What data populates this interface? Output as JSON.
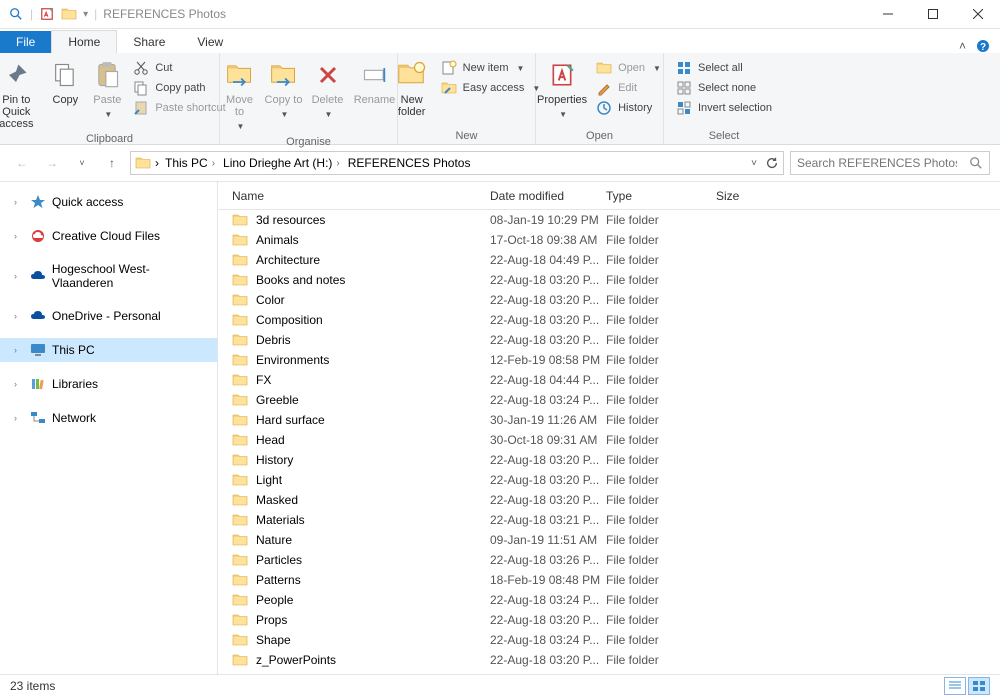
{
  "window": {
    "title": "REFERENCES Photos"
  },
  "tabs": {
    "file": "File",
    "home": "Home",
    "share": "Share",
    "view": "View"
  },
  "ribbon": {
    "pin": "Pin to Quick access",
    "copy": "Copy",
    "paste": "Paste",
    "cut": "Cut",
    "copypath": "Copy path",
    "pasteshortcut": "Paste shortcut",
    "clipboard_label": "Clipboard",
    "moveto": "Move to",
    "copyto": "Copy to",
    "delete": "Delete",
    "rename": "Rename",
    "organise_label": "Organise",
    "newfolder": "New folder",
    "newitem": "New item",
    "easyaccess": "Easy access",
    "new_label": "New",
    "properties": "Properties",
    "open": "Open",
    "edit": "Edit",
    "history": "History",
    "open_label": "Open",
    "selectall": "Select all",
    "selectnone": "Select none",
    "invert": "Invert selection",
    "select_label": "Select"
  },
  "breadcrumb": [
    "This PC",
    "Lino Drieghe Art (H:)",
    "REFERENCES Photos"
  ],
  "search_placeholder": "Search REFERENCES Photos",
  "sidebar": {
    "quickaccess": "Quick access",
    "ccf": "Creative Cloud Files",
    "hogeschool": "Hogeschool West-Vlaanderen",
    "onedrive": "OneDrive - Personal",
    "thispc": "This PC",
    "libraries": "Libraries",
    "network": "Network"
  },
  "columns": {
    "name": "Name",
    "date": "Date modified",
    "type": "Type",
    "size": "Size"
  },
  "status": {
    "count": "23 items"
  },
  "folders": [
    {
      "name": "3d resources",
      "date": "08-Jan-19 10:29 PM",
      "type": "File folder"
    },
    {
      "name": "Animals",
      "date": "17-Oct-18 09:38 AM",
      "type": "File folder"
    },
    {
      "name": "Architecture",
      "date": "22-Aug-18 04:49 P...",
      "type": "File folder"
    },
    {
      "name": "Books and notes",
      "date": "22-Aug-18 03:20 P...",
      "type": "File folder"
    },
    {
      "name": "Color",
      "date": "22-Aug-18 03:20 P...",
      "type": "File folder"
    },
    {
      "name": "Composition",
      "date": "22-Aug-18 03:20 P...",
      "type": "File folder"
    },
    {
      "name": "Debris",
      "date": "22-Aug-18 03:20 P...",
      "type": "File folder"
    },
    {
      "name": "Environments",
      "date": "12-Feb-19 08:58 PM",
      "type": "File folder"
    },
    {
      "name": "FX",
      "date": "22-Aug-18 04:44 P...",
      "type": "File folder"
    },
    {
      "name": "Greeble",
      "date": "22-Aug-18 03:24 P...",
      "type": "File folder"
    },
    {
      "name": "Hard surface",
      "date": "30-Jan-19 11:26 AM",
      "type": "File folder"
    },
    {
      "name": "Head",
      "date": "30-Oct-18 09:31 AM",
      "type": "File folder"
    },
    {
      "name": "History",
      "date": "22-Aug-18 03:20 P...",
      "type": "File folder"
    },
    {
      "name": "Light",
      "date": "22-Aug-18 03:20 P...",
      "type": "File folder"
    },
    {
      "name": "Masked",
      "date": "22-Aug-18 03:20 P...",
      "type": "File folder"
    },
    {
      "name": "Materials",
      "date": "22-Aug-18 03:21 P...",
      "type": "File folder"
    },
    {
      "name": "Nature",
      "date": "09-Jan-19 11:51 AM",
      "type": "File folder"
    },
    {
      "name": "Particles",
      "date": "22-Aug-18 03:26 P...",
      "type": "File folder"
    },
    {
      "name": "Patterns",
      "date": "18-Feb-19 08:48 PM",
      "type": "File folder"
    },
    {
      "name": "People",
      "date": "22-Aug-18 03:24 P...",
      "type": "File folder"
    },
    {
      "name": "Props",
      "date": "22-Aug-18 03:20 P...",
      "type": "File folder"
    },
    {
      "name": "Shape",
      "date": "22-Aug-18 03:24 P...",
      "type": "File folder"
    },
    {
      "name": "z_PowerPoints",
      "date": "22-Aug-18 03:20 P...",
      "type": "File folder"
    }
  ]
}
